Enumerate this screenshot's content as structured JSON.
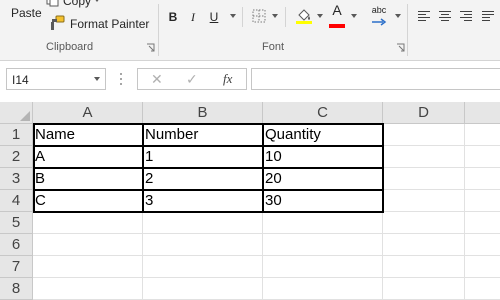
{
  "ribbon": {
    "clipboard": {
      "paste_label": "Paste",
      "copy_label": "Copy",
      "format_painter_label": "Format Painter",
      "group_label": "Clipboard"
    },
    "font": {
      "bold_label": "B",
      "italic_label": "I",
      "underline_label": "U",
      "font_color_letter": "A",
      "group_label": "Font",
      "highlight_color": "#ffff00",
      "font_color": "#ff0000"
    },
    "alignment": {
      "orientation_label": "abc"
    }
  },
  "formula_bar": {
    "name_box_value": "I14",
    "cancel_symbol": "✕",
    "enter_symbol": "✓",
    "fx_label": "fx",
    "formula_value": ""
  },
  "sheet": {
    "columns": [
      "A",
      "B",
      "C",
      "D"
    ],
    "rows": [
      "1",
      "2",
      "3",
      "4",
      "5",
      "6",
      "7",
      "8"
    ],
    "table": {
      "header": [
        "Name",
        "Number",
        "Quantity"
      ],
      "data": [
        [
          "A",
          "1",
          "10"
        ],
        [
          "B",
          "2",
          "20"
        ],
        [
          "C",
          "3",
          "30"
        ]
      ]
    }
  }
}
